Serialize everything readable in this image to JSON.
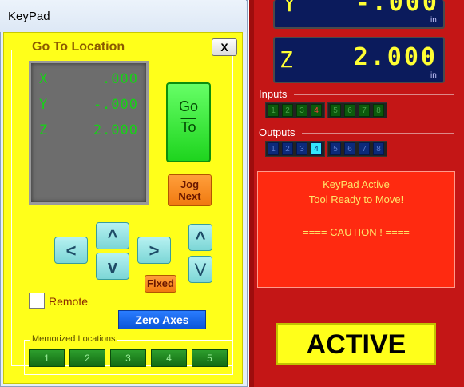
{
  "keypad": {
    "title": "KeyPad",
    "goto_label": "Go To Location",
    "close_label": "X",
    "dro": {
      "x_label": "X",
      "x_value": ".000",
      "y_label": "Y",
      "y_value": "-.000",
      "z_label": "Z",
      "z_value": "2.000"
    },
    "go_top": "Go",
    "go_bottom": "To",
    "jog_label": "Jog",
    "next_label": "Next",
    "left_arrow": "<",
    "right_arrow": ">",
    "up_arrow": "^",
    "down_arrow": "v",
    "z_up_arrow": "^",
    "z_down_arrow": "V",
    "fixed_label": "Fixed",
    "remote_label": "Remote",
    "zero_axes_label": "Zero Axes",
    "memorized_label": "Memorized Locations",
    "memorized": [
      "1",
      "2",
      "3",
      "4",
      "5"
    ]
  },
  "main": {
    "y_axis": "Y",
    "y_value": "-.000",
    "y_unit": "in",
    "z_axis": "Z",
    "z_value": "2.000",
    "z_unit": "in",
    "inputs_label": "Inputs",
    "inputs": [
      "1",
      "2",
      "3",
      "4",
      "5",
      "6",
      "7",
      "8"
    ],
    "outputs_label": "Outputs",
    "outputs": [
      "1",
      "2",
      "3",
      "4",
      "5",
      "6",
      "7",
      "8"
    ],
    "message_line1": "KeyPad Active",
    "message_line2": "Tool Ready to Move!",
    "message_line3": "==== CAUTION ! ====",
    "status": "ACTIVE",
    "colors": {
      "panel_red": "#c41616",
      "keypad_yellow": "#ffff1a",
      "dro_green": "#17d117",
      "dro_yellow": "#ffff33",
      "active_output": "#33e6ff",
      "active_input_text": "#ff4040"
    }
  }
}
